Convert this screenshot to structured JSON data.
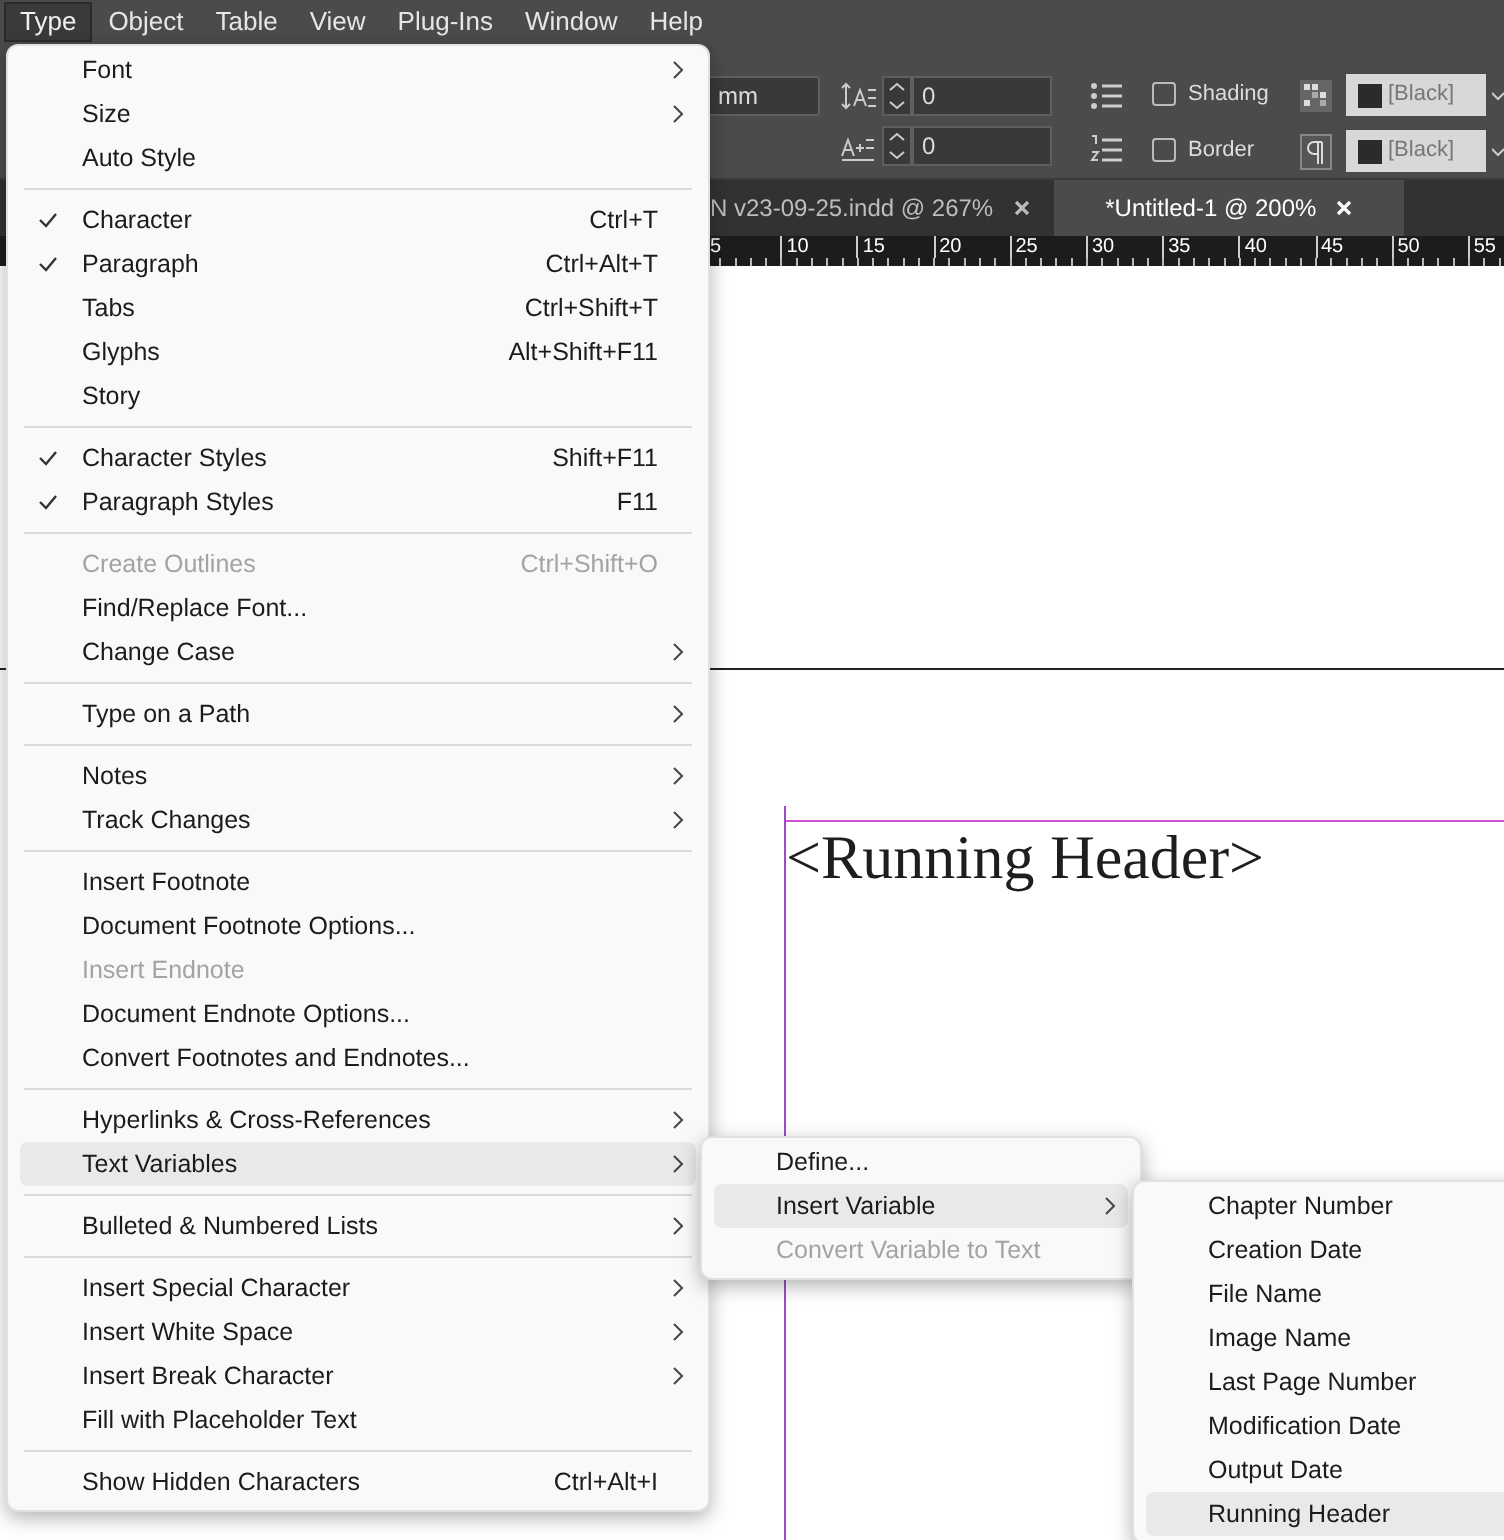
{
  "menu_bar": [
    {
      "label": "Type",
      "selected": true
    },
    {
      "label": "Object",
      "selected": false
    },
    {
      "label": "Table",
      "selected": false
    },
    {
      "label": "View",
      "selected": false
    },
    {
      "label": "Plug-Ins",
      "selected": false
    },
    {
      "label": "Window",
      "selected": false
    },
    {
      "label": "Help",
      "selected": false
    }
  ],
  "toolbar": {
    "unit_field": "mm",
    "spacing_fields": [
      "0",
      "0"
    ],
    "checkboxes": [
      {
        "label": "Shading",
        "checked": false
      },
      {
        "label": "Border",
        "checked": false
      }
    ],
    "swatch_fields": [
      "[Black]",
      "[Black]"
    ]
  },
  "document_tabs": [
    {
      "label": "N v23-09-25.indd @ 267%",
      "selected": false
    },
    {
      "label": "*Untitled-1 @ 200%",
      "selected": true
    }
  ],
  "ruler": [
    "5",
    "10",
    "15",
    "20",
    "25",
    "30",
    "35",
    "40",
    "45",
    "50",
    "55"
  ],
  "canvas": {
    "text_frame": "<Running Header>"
  },
  "type_menu": [
    {
      "kind": "item",
      "label": "Font",
      "checked": false,
      "disabled": false,
      "submenu": true,
      "selected": false
    },
    {
      "kind": "item",
      "label": "Size",
      "checked": false,
      "disabled": false,
      "submenu": true,
      "selected": false
    },
    {
      "kind": "item",
      "label": "Auto Style",
      "checked": false,
      "disabled": false,
      "submenu": false,
      "selected": false
    },
    {
      "kind": "separator"
    },
    {
      "kind": "item",
      "label": "Character",
      "shortcut": "Ctrl+T",
      "checked": true,
      "disabled": false,
      "submenu": false,
      "selected": false
    },
    {
      "kind": "item",
      "label": "Paragraph",
      "shortcut": "Ctrl+Alt+T",
      "checked": true,
      "disabled": false,
      "submenu": false,
      "selected": false
    },
    {
      "kind": "item",
      "label": "Tabs",
      "shortcut": "Ctrl+Shift+T",
      "checked": false,
      "disabled": false,
      "submenu": false,
      "selected": false
    },
    {
      "kind": "item",
      "label": "Glyphs",
      "shortcut": "Alt+Shift+F11",
      "checked": false,
      "disabled": false,
      "submenu": false,
      "selected": false
    },
    {
      "kind": "item",
      "label": "Story",
      "checked": false,
      "disabled": false,
      "submenu": false,
      "selected": false
    },
    {
      "kind": "separator"
    },
    {
      "kind": "item",
      "label": "Character Styles",
      "shortcut": "Shift+F11",
      "checked": true,
      "disabled": false,
      "submenu": false,
      "selected": false
    },
    {
      "kind": "item",
      "label": "Paragraph Styles",
      "shortcut": "F11",
      "checked": true,
      "disabled": false,
      "submenu": false,
      "selected": false
    },
    {
      "kind": "separator"
    },
    {
      "kind": "item",
      "label": "Create Outlines",
      "shortcut": "Ctrl+Shift+O",
      "checked": false,
      "disabled": true,
      "submenu": false,
      "selected": false
    },
    {
      "kind": "item",
      "label": "Find/Replace Font...",
      "checked": false,
      "disabled": false,
      "submenu": false,
      "selected": false
    },
    {
      "kind": "item",
      "label": "Change Case",
      "checked": false,
      "disabled": false,
      "submenu": true,
      "selected": false
    },
    {
      "kind": "separator"
    },
    {
      "kind": "item",
      "label": "Type on a Path",
      "checked": false,
      "disabled": false,
      "submenu": true,
      "selected": false
    },
    {
      "kind": "separator"
    },
    {
      "kind": "item",
      "label": "Notes",
      "checked": false,
      "disabled": false,
      "submenu": true,
      "selected": false
    },
    {
      "kind": "item",
      "label": "Track Changes",
      "checked": false,
      "disabled": false,
      "submenu": true,
      "selected": false
    },
    {
      "kind": "separator"
    },
    {
      "kind": "item",
      "label": "Insert Footnote",
      "checked": false,
      "disabled": false,
      "submenu": false,
      "selected": false
    },
    {
      "kind": "item",
      "label": "Document Footnote Options...",
      "checked": false,
      "disabled": false,
      "submenu": false,
      "selected": false
    },
    {
      "kind": "item",
      "label": "Insert Endnote",
      "checked": false,
      "disabled": true,
      "submenu": false,
      "selected": false
    },
    {
      "kind": "item",
      "label": "Document Endnote Options...",
      "checked": false,
      "disabled": false,
      "submenu": false,
      "selected": false
    },
    {
      "kind": "item",
      "label": "Convert Footnotes and Endnotes...",
      "checked": false,
      "disabled": false,
      "submenu": false,
      "selected": false
    },
    {
      "kind": "separator"
    },
    {
      "kind": "item",
      "label": "Hyperlinks & Cross-References",
      "checked": false,
      "disabled": false,
      "submenu": true,
      "selected": false
    },
    {
      "kind": "item",
      "label": "Text Variables",
      "checked": false,
      "disabled": false,
      "submenu": true,
      "selected": true
    },
    {
      "kind": "separator"
    },
    {
      "kind": "item",
      "label": "Bulleted & Numbered Lists",
      "checked": false,
      "disabled": false,
      "submenu": true,
      "selected": false
    },
    {
      "kind": "separator"
    },
    {
      "kind": "item",
      "label": "Insert Special Character",
      "checked": false,
      "disabled": false,
      "submenu": true,
      "selected": false
    },
    {
      "kind": "item",
      "label": "Insert White Space",
      "checked": false,
      "disabled": false,
      "submenu": true,
      "selected": false
    },
    {
      "kind": "item",
      "label": "Insert Break Character",
      "checked": false,
      "disabled": false,
      "submenu": true,
      "selected": false
    },
    {
      "kind": "item",
      "label": "Fill with Placeholder Text",
      "checked": false,
      "disabled": false,
      "submenu": false,
      "selected": false
    },
    {
      "kind": "separator"
    },
    {
      "kind": "item",
      "label": "Show Hidden Characters",
      "shortcut": "Ctrl+Alt+I",
      "checked": false,
      "disabled": false,
      "submenu": false,
      "selected": false
    }
  ],
  "text_variables_menu": [
    {
      "kind": "item",
      "label": "Define...",
      "checked": false,
      "disabled": false,
      "submenu": false,
      "selected": false
    },
    {
      "kind": "item",
      "label": "Insert Variable",
      "checked": false,
      "disabled": false,
      "submenu": true,
      "selected": true
    },
    {
      "kind": "item",
      "label": "Convert Variable to Text",
      "checked": false,
      "disabled": true,
      "submenu": false,
      "selected": false
    }
  ],
  "insert_variable_menu": [
    {
      "kind": "item",
      "label": "Chapter Number",
      "checked": false,
      "disabled": false,
      "submenu": false,
      "selected": false
    },
    {
      "kind": "item",
      "label": "Creation Date",
      "checked": false,
      "disabled": false,
      "submenu": false,
      "selected": false
    },
    {
      "kind": "item",
      "label": "File Name",
      "checked": false,
      "disabled": false,
      "submenu": false,
      "selected": false
    },
    {
      "kind": "item",
      "label": "Image Name",
      "checked": false,
      "disabled": false,
      "submenu": false,
      "selected": false
    },
    {
      "kind": "item",
      "label": "Last Page Number",
      "checked": false,
      "disabled": false,
      "submenu": false,
      "selected": false
    },
    {
      "kind": "item",
      "label": "Modification Date",
      "checked": false,
      "disabled": false,
      "submenu": false,
      "selected": false
    },
    {
      "kind": "item",
      "label": "Output Date",
      "checked": false,
      "disabled": false,
      "submenu": false,
      "selected": false
    },
    {
      "kind": "item",
      "label": "Running Header",
      "checked": false,
      "disabled": false,
      "submenu": false,
      "selected": true
    }
  ]
}
